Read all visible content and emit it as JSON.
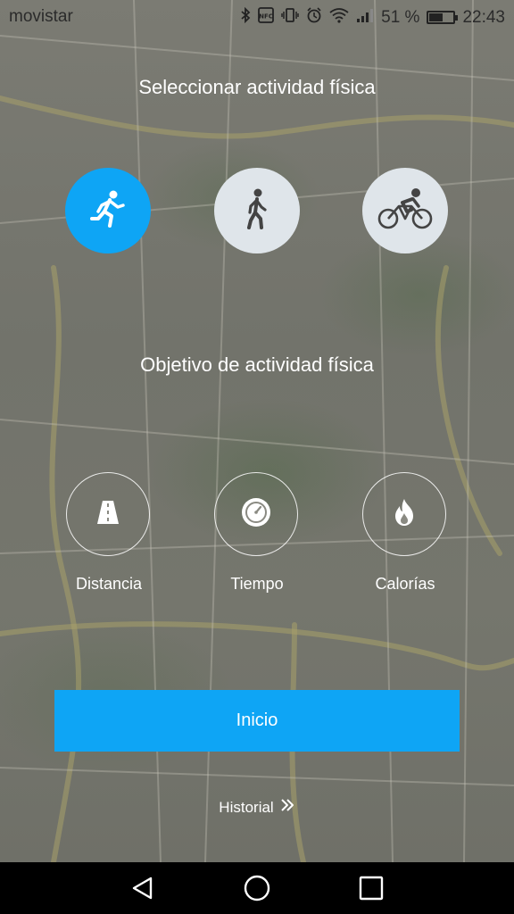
{
  "status_bar": {
    "carrier": "movistar",
    "battery_percent": "51 %",
    "time": "22:43",
    "icons": [
      "bluetooth-icon",
      "nfc-icon",
      "vibrate-icon",
      "alarm-icon",
      "wifi-icon",
      "signal-icon",
      "battery-icon"
    ],
    "battery_level": 0.51
  },
  "activity": {
    "title": "Seleccionar actividad física",
    "options": [
      {
        "icon": "running-icon",
        "selected": true
      },
      {
        "icon": "walking-icon",
        "selected": false
      },
      {
        "icon": "cycling-icon",
        "selected": false
      }
    ]
  },
  "goal": {
    "title": "Objetivo de actividad física",
    "options": [
      {
        "icon": "road-icon",
        "label": "Distancia"
      },
      {
        "icon": "stopwatch-icon",
        "label": "Tiempo"
      },
      {
        "icon": "flame-icon",
        "label": "Calorías"
      }
    ]
  },
  "start_button": {
    "label": "Inicio"
  },
  "history_link": {
    "label": "Historial"
  },
  "nav_bar": {
    "icons": [
      "back-icon",
      "home-icon",
      "recents-icon"
    ]
  },
  "colors": {
    "accent": "#0ea5f5",
    "unselected": "#dfe5ea",
    "text": "#ffffff"
  }
}
